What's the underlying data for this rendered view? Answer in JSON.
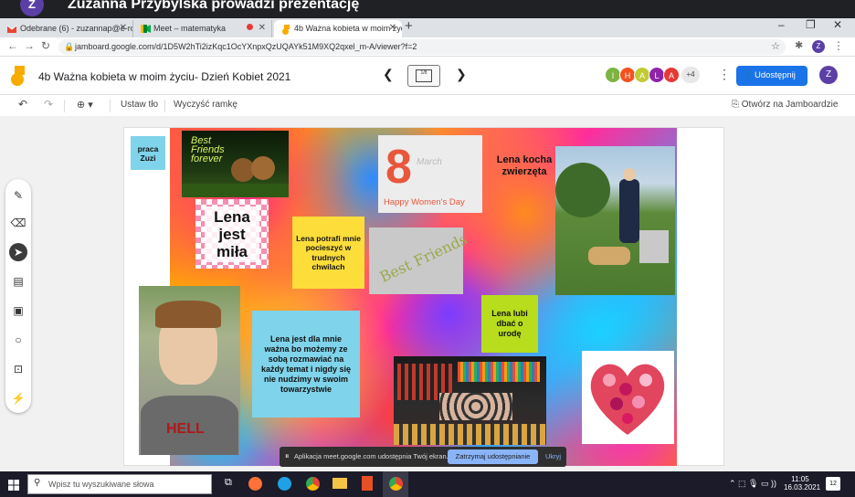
{
  "meet": {
    "avatar_letter": "Z",
    "title": "Zuzanna Przybylska prowadzi prezentację"
  },
  "tabs": [
    {
      "label": "Odebrane (6) - zuzannap@e-roj",
      "icon": "gmail-icon"
    },
    {
      "label": "Meet – matematyka",
      "icon": "meet-icon"
    },
    {
      "label": "4b Ważna kobieta w moim życiu",
      "icon": "jamboard-icon"
    }
  ],
  "address": {
    "url": "jamboard.google.com/d/1D5W2hTi2izKqc1OcYXnpxQzUQAYk51M9XQ2qxel_m-A/viewer?f=2"
  },
  "app": {
    "doc_title": "4b Ważna kobieta w moim życiu- Dzień Kobiet 2021",
    "frame_label": "1/8",
    "collaborators": [
      {
        "letter": "I",
        "color": "#7cb342"
      },
      {
        "letter": "H",
        "color": "#f4511e"
      },
      {
        "letter": "A",
        "color": "#c0ca33"
      },
      {
        "letter": "L",
        "color": "#8e24aa"
      },
      {
        "letter": "A",
        "color": "#e53935"
      }
    ],
    "more_count": "+4",
    "share_label": "Udostępnij",
    "user_letter": "Z"
  },
  "toolbar": {
    "set_background": "Ustaw tło",
    "clear_frame": "Wyczyść ramkę",
    "open_in_jamboard": "Otwórz na Jamboardzie"
  },
  "board": {
    "note_praca": "praca Zuzi",
    "friends_photo_text": "Best Friends forever",
    "lena_mila": "Lena jest miła",
    "note_pocieszyc": "Lena potrafi mnie pocieszyć w trudnych chwilach",
    "card_8march_number": "8",
    "card_8march_month": "March",
    "card_8march_caption": "Happy Women's Day",
    "best_friends_card": "Best Friends",
    "lena_kocha": "Lena kocha zwierzęta",
    "note_uroda": "Lena lubi dbać o urodę",
    "note_wazna": "Lena jest dla mnie ważna bo możemy ze sobą rozmawiać na każdy temat i nigdy się nie nudzimy w swoim towarzystwie",
    "girl_shirt": "HELL"
  },
  "share_notice": {
    "text": "Aplikacja meet.google.com udostępnia Twój ekran.",
    "stop_label": "Zatrzymaj udostępnianie",
    "hide_label": "Ukryj"
  },
  "taskbar": {
    "search_placeholder": "Wpisz tu wyszukiwane słowa",
    "time": "11:05",
    "date": "16.03.2021",
    "notif_count": "12"
  }
}
